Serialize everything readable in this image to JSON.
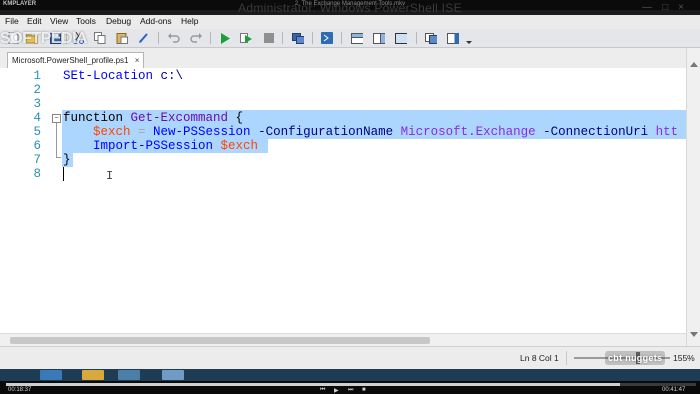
{
  "player": {
    "brand": "KMPLAYER",
    "title": "2. The Exchange Management Tools.mkv",
    "current_time": "00:18:37",
    "total_time": "00:41:47",
    "progress_fraction": 0.89
  },
  "window": {
    "title": "Administrator: Windows PowerShell ISE"
  },
  "watermark": {
    "text": "SOFTPEDIA"
  },
  "menu": {
    "items": [
      "File",
      "Edit",
      "View",
      "Tools",
      "Debug",
      "Add-ons",
      "Help"
    ]
  },
  "toolbar": {
    "buttons": [
      "new-script",
      "open",
      "save",
      "cut",
      "copy",
      "paste",
      "clear-console",
      "undo",
      "redo",
      "run-script",
      "run-selection",
      "stop",
      "new-remote-tab",
      "start-powershell",
      "show-script-pane-top",
      "show-script-pane-right",
      "show-script-pane-max",
      "show-command-window",
      "show-command-addon"
    ]
  },
  "tab": {
    "filename": "Microsoft.PowerShell_profile.ps1",
    "close": "×"
  },
  "editor": {
    "line_numbers": [
      "1",
      "2",
      "3",
      "4",
      "5",
      "6",
      "7",
      "8"
    ],
    "lines": {
      "l1": {
        "cmd": "SEt-Location",
        "arg": " c:\\"
      },
      "l4": {
        "kw": "function",
        "fn": " Get-Excommand",
        "brace": " {"
      },
      "l5": {
        "indent": "    ",
        "var": "$exch",
        "eq": " = ",
        "cmd": "New-PSSession",
        "p1": " -ConfigurationName",
        "v1": " Microsoft.Exchange",
        "p2": " -ConnectionUri",
        "v2": " htt"
      },
      "l6": {
        "indent": "    ",
        "cmd": "Import-PSSession",
        "var": " $exch"
      },
      "l7": {
        "brace": "}"
      }
    },
    "fold_symbol": "−"
  },
  "status": {
    "position": "Ln 8  Col 1",
    "zoom": "155%"
  },
  "overlay": {
    "brand": "cbt nuggets"
  },
  "colors": {
    "selection": "#add6ff",
    "line_number": "#2b91af",
    "taskbar": "#1f3c55"
  }
}
